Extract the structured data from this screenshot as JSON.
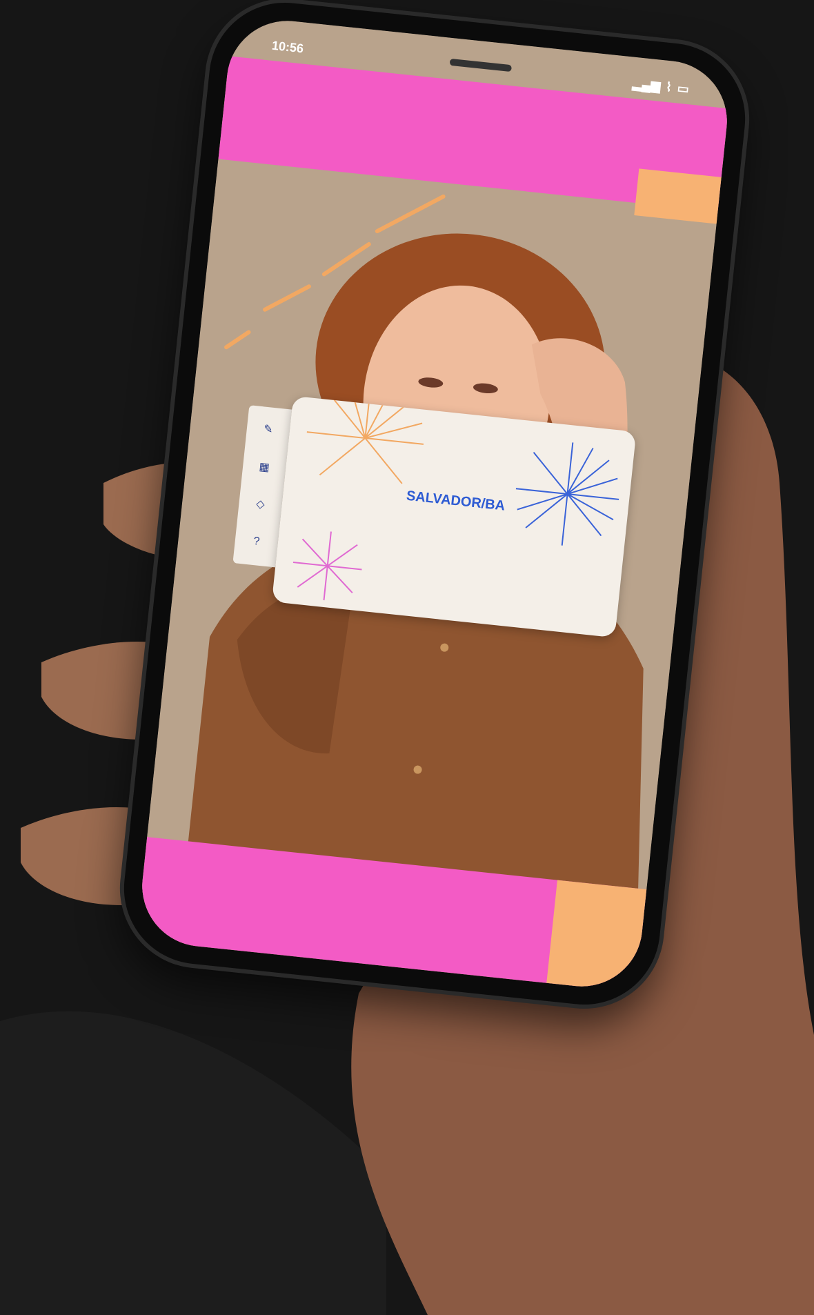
{
  "status_bar": {
    "time": "10:56",
    "signal": "▂▄▆",
    "wifi": "wifi-icon",
    "battery": "battery-icon"
  },
  "colors": {
    "pink": "#f35bc5",
    "peach": "#f7b273",
    "card_bg": "#f4efe8",
    "city_blue": "#2d5bd3"
  },
  "sidebar": {
    "items": [
      {
        "icon": "brush-icon",
        "label": ""
      },
      {
        "icon": "grid-icon",
        "label": ""
      },
      {
        "icon": "diamond-icon",
        "label": ""
      },
      {
        "icon": "help-icon",
        "label": ""
      }
    ]
  },
  "card": {
    "city": "SALVADOR/BA"
  }
}
